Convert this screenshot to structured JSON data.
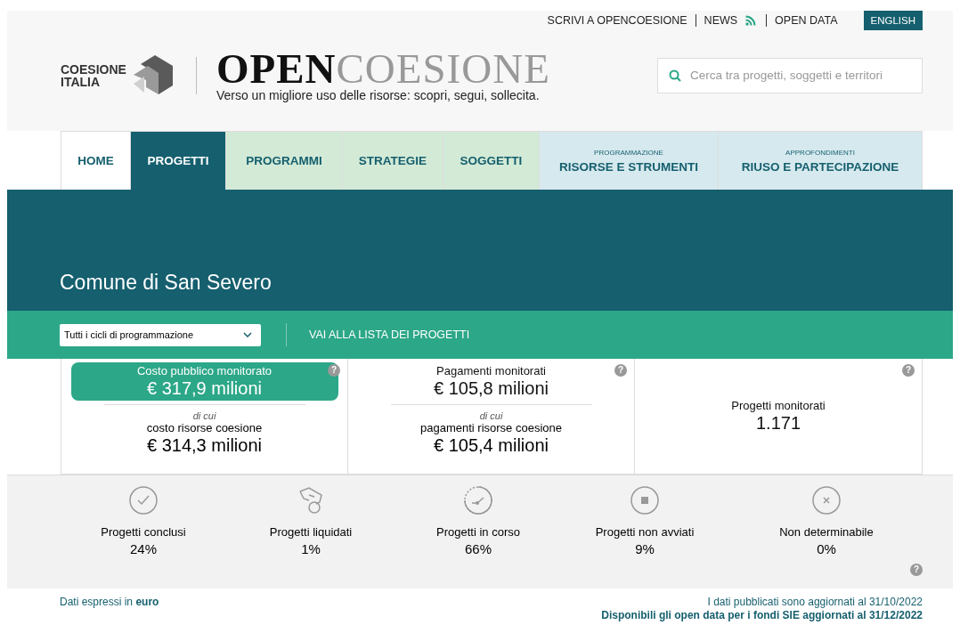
{
  "top_links": [
    {
      "label": "SCRIVI A OPENCOESIONE",
      "kind": "link"
    },
    {
      "label": "NEWS",
      "kind": "rss"
    },
    {
      "label": "OPEN DATA",
      "kind": "link"
    }
  ],
  "language_button": "ENGLISH",
  "logo": {
    "name_line1": "COESIONE",
    "name_line2": "ITALIA",
    "title_bold": "OPEN",
    "title_light": "COESIONE",
    "tagline": "Verso un migliore uso delle risorse: scopri, segui, sollecita."
  },
  "search": {
    "placeholder": "Cerca tra progetti, soggetti e territori"
  },
  "help_mark": "?",
  "tabs": [
    {
      "label": "HOME",
      "kind": "main",
      "selected": false
    },
    {
      "label": "PROGETTI",
      "kind": "main",
      "selected": true
    },
    {
      "label": "PROGRAMMI",
      "kind": "theme",
      "selected": false
    },
    {
      "label": "STRATEGIE",
      "kind": "theme",
      "selected": false
    },
    {
      "label": "SOGGETTI",
      "kind": "theme",
      "selected": false
    },
    {
      "label": "RISORSE E STRUMENTI",
      "overline": "PROGRAMMAZIONE",
      "kind": "extra",
      "selected": false
    },
    {
      "label": "RIUSO E PARTECIPAZIONE",
      "overline": "APPROFONDIMENTI",
      "kind": "extra",
      "selected": false
    }
  ],
  "page_title": "Comune di San Severo",
  "filter": {
    "value": "Tutti i cicli di programmazione",
    "link": "VAI ALLA LISTA DEI PROGETTI"
  },
  "stats": [
    {
      "label": "Costo pubblico monitorato",
      "value": "€ 317,9 milioni",
      "highlighted": true,
      "of_which": "di cui",
      "sub_label": "costo risorse coesione",
      "sub_value": "€ 314,3 milioni"
    },
    {
      "label": "Pagamenti monitorati",
      "value": "€ 105,8 milioni",
      "highlighted": false,
      "of_which": "di cui",
      "sub_label": "pagamenti risorse coesione",
      "sub_value": "€ 105,4 milioni"
    },
    {
      "label": "Progetti monitorati",
      "value": "1.171",
      "highlighted": false
    }
  ],
  "status": [
    {
      "kind": "check",
      "label": "Progetti conclusi",
      "value": "24%"
    },
    {
      "kind": "hand",
      "label": "Progetti liquidati",
      "value": "1%"
    },
    {
      "kind": "clock",
      "label": "Progetti in corso",
      "value": "66%"
    },
    {
      "kind": "stop",
      "label": "Progetti non avviati",
      "value": "9%"
    },
    {
      "kind": "cross",
      "label": "Non determinabile",
      "value": "0%"
    }
  ],
  "footer": {
    "currency_note": "Dati espressi in **euro**",
    "updated": "I dati pubblicati sono aggiornati al 31/10/2022",
    "open_data": "Disponibili gli open data per i fondi SIE aggiornati al 31/12/2022"
  }
}
